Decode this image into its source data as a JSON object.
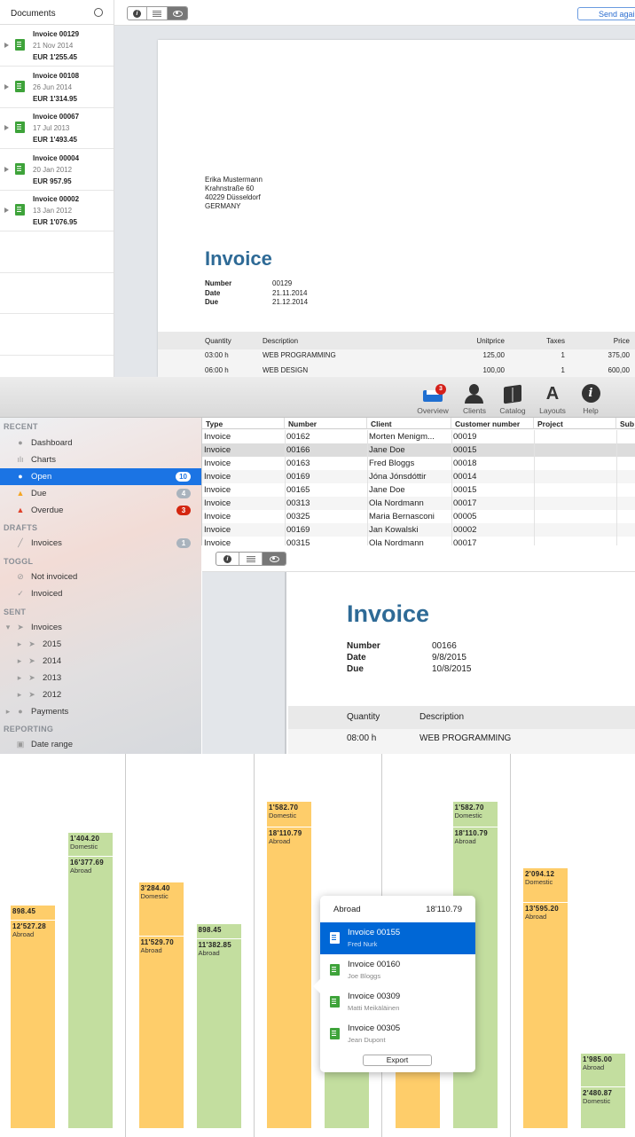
{
  "documents_panel": {
    "title": "Documents",
    "items": [
      {
        "title": "Invoice 00129",
        "date": "21 Nov 2014",
        "amount": "EUR 1'255.45"
      },
      {
        "title": "Invoice 00108",
        "date": "26 Jun 2014",
        "amount": "EUR 1'314.95"
      },
      {
        "title": "Invoice 00067",
        "date": "17 Jul 2013",
        "amount": "EUR 1'493.45"
      },
      {
        "title": "Invoice 00004",
        "date": "20 Jan 2012",
        "amount": "EUR 957.95"
      },
      {
        "title": "Invoice 00002",
        "date": "13 Jan 2012",
        "amount": "EUR 1'076.95"
      }
    ]
  },
  "top_preview": {
    "send_button": "Send agai",
    "address": [
      "Erika Mustermann",
      "Krahnstraße 60",
      "40229 Düsseldorf",
      "GERMANY"
    ],
    "title": "Invoice",
    "meta": [
      {
        "label": "Number",
        "value": "00129"
      },
      {
        "label": "Date",
        "value": "21.11.2014"
      },
      {
        "label": "Due",
        "value": "21.12.2014"
      }
    ],
    "table_headers": [
      "Quantity",
      "Description",
      "Unitprice",
      "Taxes",
      "Price"
    ],
    "rows": [
      [
        "03:00 h",
        "WEB PROGRAMMING",
        "125,00",
        "1",
        "375,00"
      ],
      [
        "06:00 h",
        "WEB DESIGN",
        "100,00",
        "1",
        "600,00"
      ]
    ]
  },
  "toolbar": {
    "overview": "Overview",
    "overview_badge": "3",
    "clients": "Clients",
    "catalog": "Catalog",
    "layouts": "Layouts",
    "help": "Help"
  },
  "sidebar": {
    "recent": "RECENT",
    "dashboard": "Dashboard",
    "charts": "Charts",
    "open": "Open",
    "open_count": "10",
    "due": "Due",
    "due_count": "4",
    "overdue": "Overdue",
    "overdue_count": "3",
    "drafts": "DRAFTS",
    "draft_invoices": "Invoices",
    "draft_count": "1",
    "toggl": "TOGGL",
    "not_invoiced": "Not invoiced",
    "invoiced": "Invoiced",
    "sent": "SENT",
    "sent_invoices": "Invoices",
    "years": [
      "2015",
      "2014",
      "2013",
      "2012"
    ],
    "payments": "Payments",
    "reporting": "REPORTING",
    "date_range": "Date range"
  },
  "table": {
    "headers": [
      "Type",
      "Number",
      "Client",
      "Customer number",
      "Project",
      "Sub"
    ],
    "rows": [
      [
        "Invoice",
        "00162",
        "Morten Menigm...",
        "00019"
      ],
      [
        "Invoice",
        "00166",
        "Jane Doe",
        "00015"
      ],
      [
        "Invoice",
        "00163",
        "Fred Bloggs",
        "00018"
      ],
      [
        "Invoice",
        "00169",
        "Jóna Jónsdóttir",
        "00014"
      ],
      [
        "Invoice",
        "00165",
        "Jane Doe",
        "00015"
      ],
      [
        "Invoice",
        "00313",
        "Ola Nordmann",
        "00017"
      ],
      [
        "Invoice",
        "00325",
        "Maria Bernasconi",
        "00005"
      ],
      [
        "Invoice",
        "00169",
        "Jan Kowalski",
        "00002"
      ],
      [
        "Invoice",
        "00315",
        "Ola Nordmann",
        "00017"
      ]
    ]
  },
  "bottom_preview": {
    "title": "Invoice",
    "meta": [
      {
        "label": "Number",
        "value": "00166"
      },
      {
        "label": "Date",
        "value": "9/8/2015"
      },
      {
        "label": "Due",
        "value": "10/8/2015"
      }
    ],
    "table_headers": [
      "Quantity",
      "Description"
    ],
    "rows": [
      [
        "08:00 h",
        "WEB PROGRAMMING"
      ]
    ]
  },
  "chart_data": {
    "type": "bar",
    "stacked": true,
    "colors": {
      "orange": "#fecd6a",
      "green": "#c3de9f"
    },
    "groups": [
      {
        "bars": [
          {
            "color": "orange",
            "segments": [
              {
                "value": 898.45,
                "text": "898.45",
                "name": ""
              },
              {
                "value": 12527.28,
                "text": "12'527.28",
                "name": "Abroad"
              }
            ]
          },
          {
            "color": "green",
            "segments": [
              {
                "value": 1404.2,
                "text": "1'404.20",
                "name": "Domestic"
              },
              {
                "value": 16377.69,
                "text": "16'377.69",
                "name": "Abroad"
              }
            ]
          }
        ]
      },
      {
        "bars": [
          {
            "color": "orange",
            "segments": [
              {
                "value": 3284.4,
                "text": "3'284.40",
                "name": "Domestic"
              },
              {
                "value": 11529.7,
                "text": "11'529.70",
                "name": "Abroad"
              }
            ]
          },
          {
            "color": "green",
            "segments": [
              {
                "value": 898.45,
                "text": "898.45",
                "name": ""
              },
              {
                "value": 11382.85,
                "text": "11'382.85",
                "name": "Abroad"
              }
            ]
          }
        ]
      },
      {
        "bars": [
          {
            "color": "orange",
            "segments": [
              {
                "value": 1582.7,
                "text": "1'582.70",
                "name": "Domestic"
              },
              {
                "value": 18110.79,
                "text": "18'110.79",
                "name": "Abroad"
              }
            ]
          },
          {
            "color": "green",
            "segments": [
              {
                "value": 3284.4,
                "text": "3'284.40",
                "name": "Domestic"
              },
              {
                "value": null,
                "text": "",
                "name": ""
              }
            ]
          }
        ]
      },
      {
        "bars": [
          {
            "color": "orange",
            "segments": [
              {
                "value": null,
                "text": "",
                "name": ""
              }
            ]
          },
          {
            "color": "green",
            "segments": [
              {
                "value": 1582.7,
                "text": "1'582.70",
                "name": "Domestic"
              },
              {
                "value": 18110.79,
                "text": "18'110.79",
                "name": "Abroad"
              }
            ]
          }
        ]
      },
      {
        "bars": [
          {
            "color": "orange",
            "segments": [
              {
                "value": 2094.12,
                "text": "2'094.12",
                "name": "Domestic"
              },
              {
                "value": 13595.2,
                "text": "13'595.20",
                "name": "Abroad"
              }
            ]
          },
          {
            "color": "green",
            "segments": [
              {
                "value": 1985.0,
                "text": "1'985.00",
                "name": "Abroad"
              },
              {
                "value": 2480.87,
                "text": "2'480.87",
                "name": "Domestic"
              }
            ]
          }
        ]
      }
    ]
  },
  "popup": {
    "title": "Abroad",
    "total": "18'110.79",
    "items": [
      {
        "number": "Invoice 00155",
        "client": "Fred Nurk"
      },
      {
        "number": "Invoice 00160",
        "client": "Joe Bloggs"
      },
      {
        "number": "Invoice 00309",
        "client": "Matti Meikäläinen"
      },
      {
        "number": "Invoice 00305",
        "client": "Jean Dupont"
      }
    ],
    "export_button": "Export"
  }
}
